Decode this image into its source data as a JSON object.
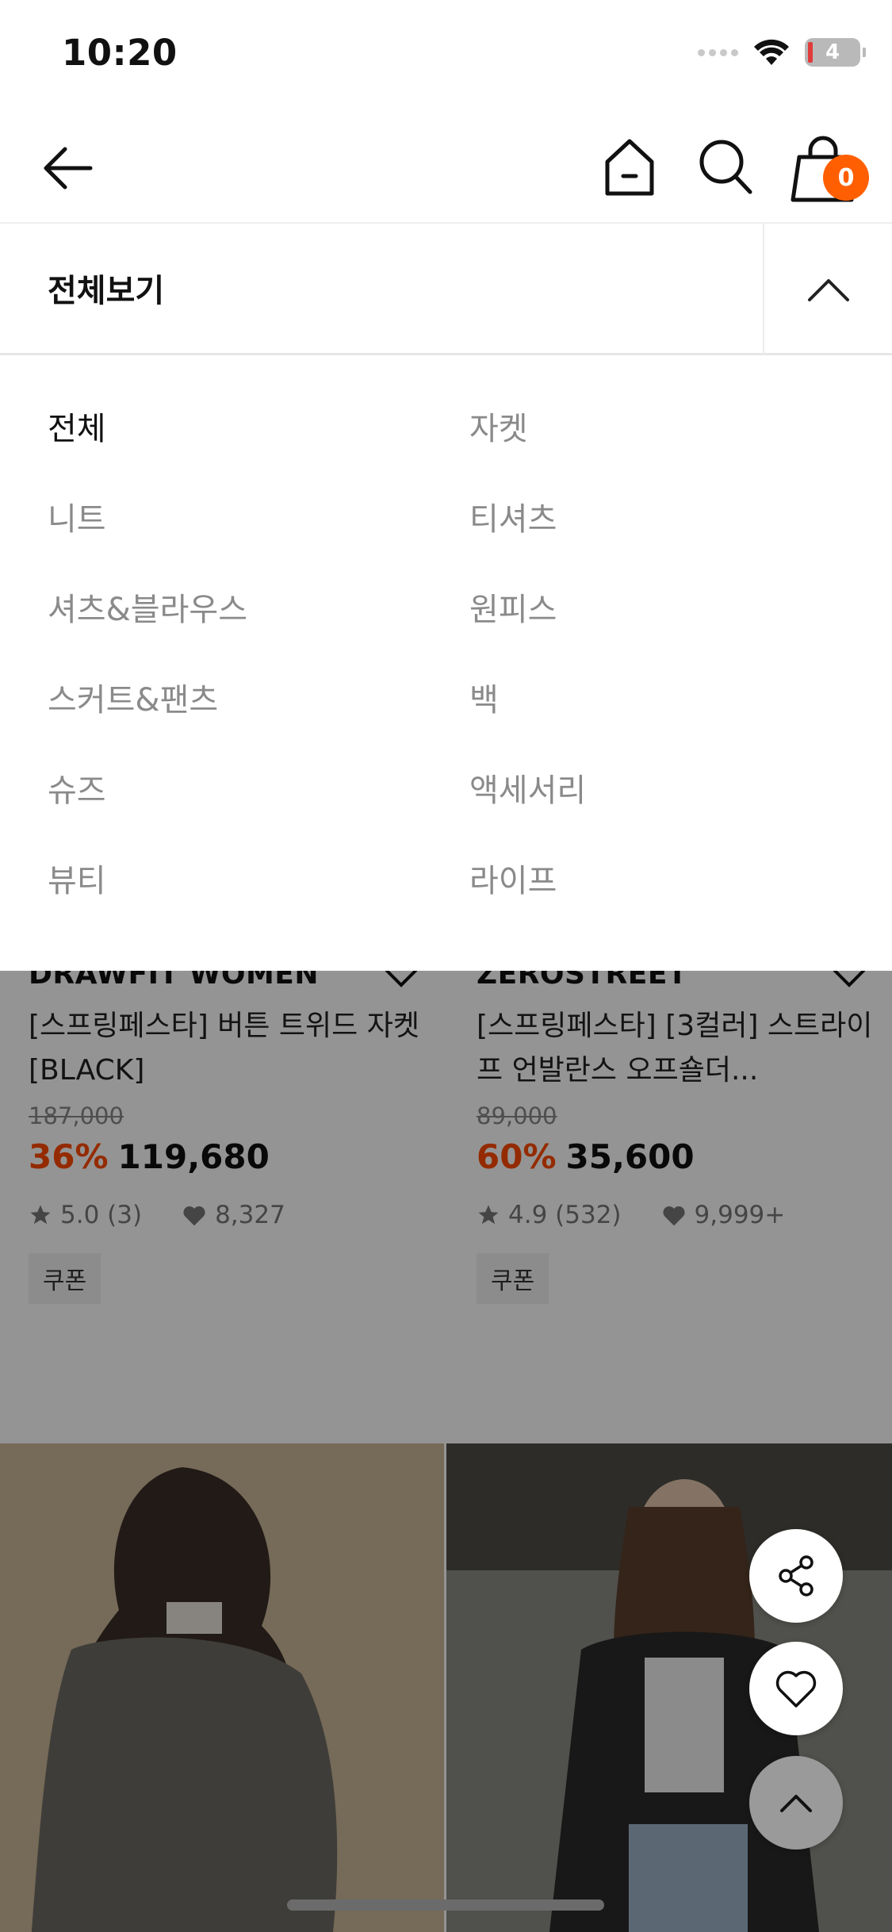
{
  "status": {
    "time": "10:20",
    "battery": "4"
  },
  "nav": {
    "cart_count": "0"
  },
  "category": {
    "header_title": "전체보기",
    "items_left": [
      "전체",
      "니트",
      "셔츠&블라우스",
      "스커트&팬츠",
      "슈즈",
      "뷰티"
    ],
    "items_right": [
      "자켓",
      "티셔츠",
      "원피스",
      "백",
      "액세서리",
      "라이프"
    ],
    "active": "전체"
  },
  "products": [
    {
      "brand": "DRAWFIT WOMEN",
      "name": "[스프링페스타] 버튼 트위드 자켓 [BLACK]",
      "original_price": "187,000",
      "discount": "36%",
      "price": "119,680",
      "rating": "5.0 (3)",
      "likes": "8,327",
      "coupon": "쿠폰"
    },
    {
      "brand": "ZEROSTREET",
      "name": "[스프링페스타] [3컬러] 스트라이프 언발란스 오프숄더...",
      "original_price": "89,000",
      "discount": "60%",
      "price": "35,600",
      "rating": "4.9 (532)",
      "likes": "9,999+",
      "coupon": "쿠폰"
    }
  ],
  "colors": {
    "accent": "#ff5f00",
    "discount": "#ff4b00"
  }
}
